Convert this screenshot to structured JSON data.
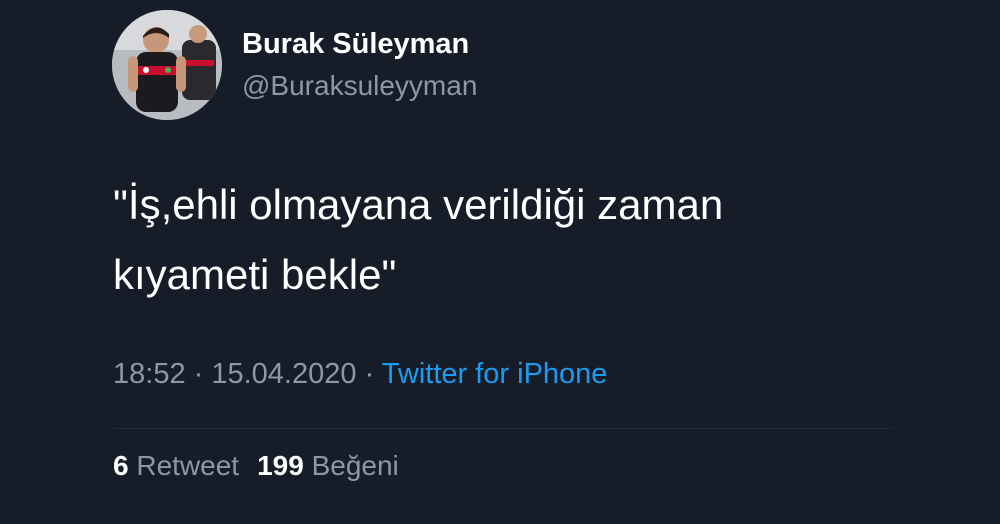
{
  "author": {
    "display_name": "Burak Süleyman",
    "handle": "@Buraksuleyyman",
    "avatar_icon": "profile-photo-icon"
  },
  "tweet": {
    "text_line1": "\"İş,ehli olmayana verildiği zaman",
    "text_line2": "kıyameti bekle\""
  },
  "meta": {
    "time": "18:52",
    "separator1": " · ",
    "date": "15.04.2020",
    "separator2": " · ",
    "source": "Twitter for iPhone"
  },
  "stats": {
    "retweet_count": "6",
    "retweet_label": "Retweet",
    "like_count": "199",
    "like_label": "Beğeni"
  },
  "colors": {
    "background": "#161d28",
    "primary_text": "#ffffff",
    "secondary_text": "#8b98a5",
    "link": "#1d9bf0"
  }
}
